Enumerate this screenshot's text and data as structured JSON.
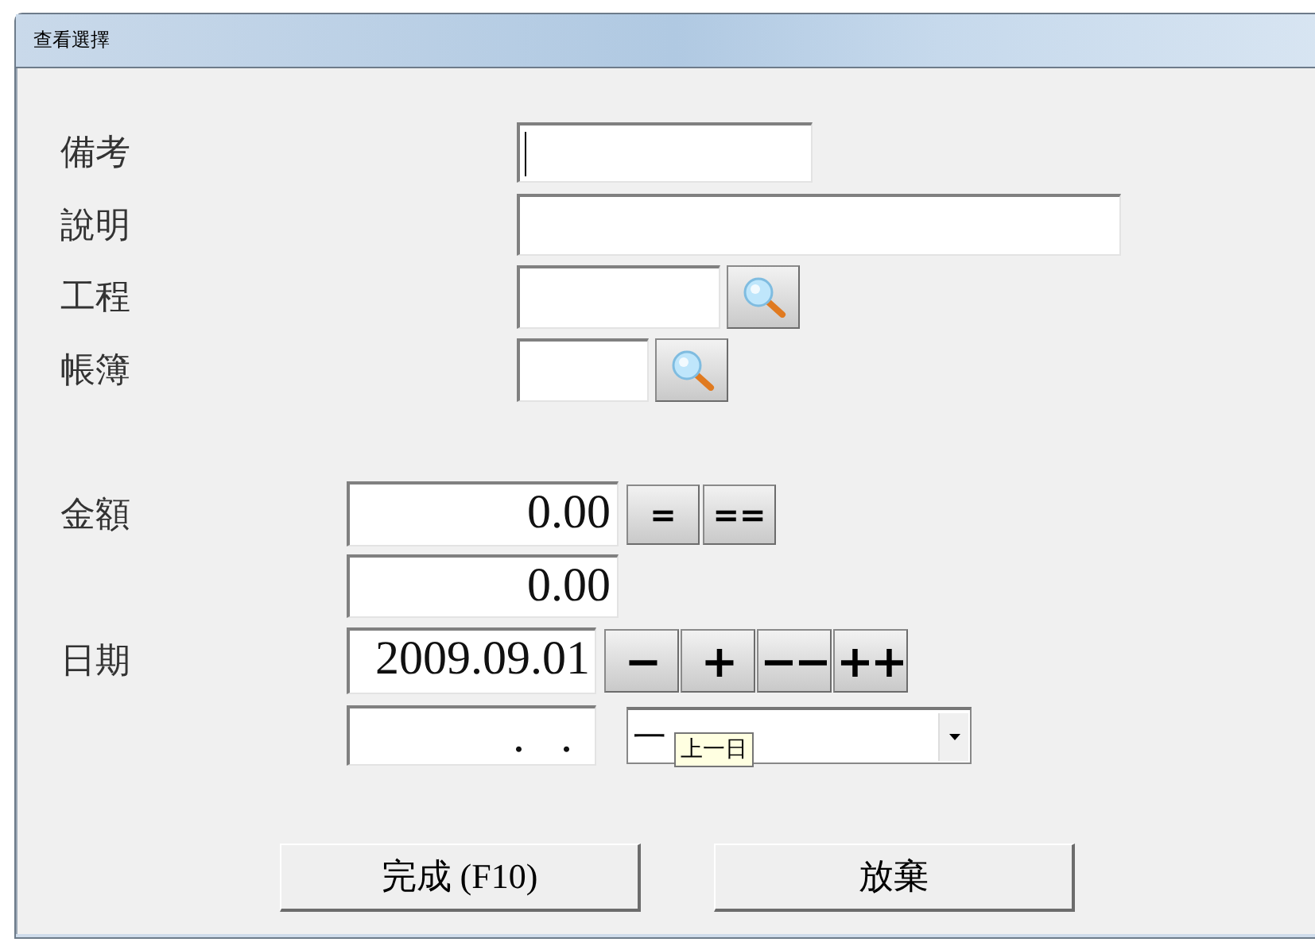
{
  "window": {
    "title": "查看選擇"
  },
  "rows": [
    {
      "kind": "text",
      "label": "備考",
      "focused": true
    },
    {
      "kind": "text",
      "label": "說明",
      "focused": false
    },
    {
      "kind": "lookup",
      "label": "工程",
      "focused": false
    },
    {
      "kind": "lookup",
      "label": "帳簿",
      "focused": false
    },
    {
      "kind": "number",
      "label": "金額",
      "value": "0.00",
      "buttons": [
        "=",
        "=="
      ]
    },
    {
      "kind": "number",
      "value": "0.00"
    },
    {
      "kind": "date",
      "label": "日期",
      "value": "2009.09.01",
      "buttons": [
        "−",
        "+",
        "−−",
        "++"
      ]
    },
    {
      "kind": "range",
      "value": ".   .",
      "dropdown": "一",
      "tooltip": "上一日"
    }
  ],
  "actions": [
    "完成 (F10)",
    "放棄"
  ]
}
